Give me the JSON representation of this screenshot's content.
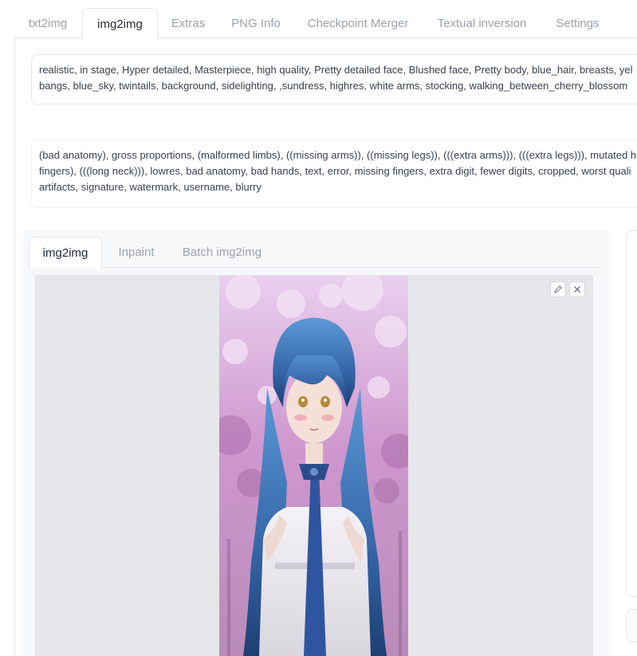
{
  "main_tabs": [
    "txt2img",
    "img2img",
    "Extras",
    "PNG Info",
    "Checkpoint Merger",
    "Textual inversion",
    "Settings"
  ],
  "active_main_tab": "img2img",
  "prompt": {
    "lines": [
      "realistic, in stage, Hyper detailed,  Masterpiece, high quality, Pretty detailed face, Blushed face, Pretty body, blue_hair, breasts, yel",
      "bangs, blue_sky, twintails, background, sidelighting, ,sundress, highres, white arms, stocking, walking_between_cherry_blossom"
    ]
  },
  "negative_prompt": {
    "lines": [
      "(bad anatomy), gross proportions, (malformed limbs), ((missing arms)), ((missing legs)), (((extra arms))), (((extra legs))), mutated h",
      "fingers), (((long neck))), lowres, bad anatomy, bad hands, text, error, missing fingers, extra digit, fewer digits, cropped, worst quali",
      "artifacts, signature, watermark, username, blurry"
    ]
  },
  "sub_tabs": [
    "img2img",
    "Inpaint",
    "Batch img2img"
  ],
  "active_sub_tab": "img2img",
  "image_tools": {
    "edit": "pencil-icon",
    "clear": "close-icon"
  },
  "colors": {
    "hair": "#3d6fb0",
    "blossom": "#d7a9d8",
    "dress": "#eceaf0",
    "tab_inactive": "#9ca3af"
  }
}
